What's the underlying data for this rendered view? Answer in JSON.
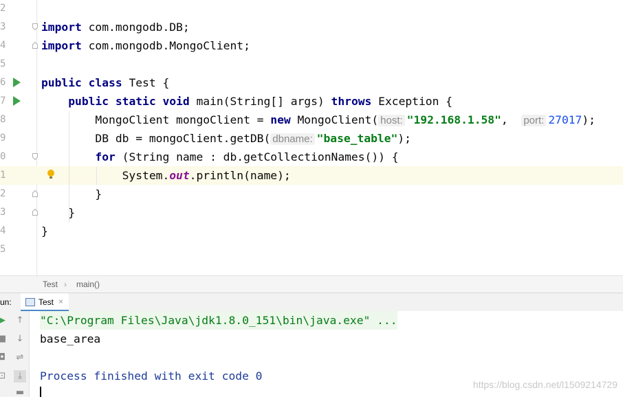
{
  "editor": {
    "lines": [
      {
        "num": "2",
        "tokens": []
      },
      {
        "num": "3",
        "tokens": [
          {
            "t": "import",
            "c": "kw"
          },
          {
            "t": " com.mongodb.DB;",
            "c": ""
          }
        ]
      },
      {
        "num": "4",
        "tokens": [
          {
            "t": "import",
            "c": "kw"
          },
          {
            "t": " com.mongodb.MongoClient;",
            "c": ""
          }
        ]
      },
      {
        "num": "5",
        "tokens": []
      },
      {
        "num": "6",
        "tokens": [
          {
            "t": "public class",
            "c": "kw"
          },
          {
            "t": " Test {",
            "c": ""
          }
        ]
      },
      {
        "num": "7",
        "tokens": [
          {
            "t": "    ",
            "c": ""
          },
          {
            "t": "public static void",
            "c": "kw"
          },
          {
            "t": " main(String[] args) ",
            "c": ""
          },
          {
            "t": "throws",
            "c": "kw"
          },
          {
            "t": " Exception {",
            "c": ""
          }
        ]
      },
      {
        "num": "8",
        "tokens": [
          {
            "t": "        MongoClient mongoClient = ",
            "c": ""
          },
          {
            "t": "new",
            "c": "kw"
          },
          {
            "t": " MongoClient(",
            "c": ""
          },
          {
            "t": "host:",
            "c": "hint"
          },
          {
            "t": "\"192.168.1.58\"",
            "c": "str"
          },
          {
            "t": ",  ",
            "c": ""
          },
          {
            "t": "port:",
            "c": "hint"
          },
          {
            "t": "27017",
            "c": "num"
          },
          {
            "t": ");",
            "c": ""
          }
        ]
      },
      {
        "num": "9",
        "tokens": [
          {
            "t": "        DB db = mongoClient.getDB(",
            "c": ""
          },
          {
            "t": "dbname:",
            "c": "hint"
          },
          {
            "t": "\"base_table\"",
            "c": "str"
          },
          {
            "t": ");",
            "c": ""
          }
        ]
      },
      {
        "num": "0",
        "tokens": [
          {
            "t": "        ",
            "c": ""
          },
          {
            "t": "for",
            "c": "kw"
          },
          {
            "t": " (String name : db.getCollectionNames()) {",
            "c": ""
          }
        ]
      },
      {
        "num": "1",
        "tokens": [
          {
            "t": "            System.",
            "c": ""
          },
          {
            "t": "out",
            "c": "fld"
          },
          {
            "t": ".println(name);",
            "c": ""
          }
        ]
      },
      {
        "num": "2",
        "tokens": [
          {
            "t": "        }",
            "c": ""
          }
        ]
      },
      {
        "num": "3",
        "tokens": [
          {
            "t": "    }",
            "c": ""
          }
        ]
      },
      {
        "num": "4",
        "tokens": [
          {
            "t": "}",
            "c": ""
          }
        ]
      },
      {
        "num": "5",
        "tokens": []
      }
    ]
  },
  "breadcrumb": {
    "class_name": "Test",
    "method_name": "main()"
  },
  "run_panel": {
    "run_label": "un:",
    "tab_label": "Test",
    "close_glyph": "×",
    "command_line": "\"C:\\Program Files\\Java\\jdk1.8.0_151\\bin\\java.exe\" ...",
    "output_line": "base_area",
    "exit_message": "Process finished with exit code 0"
  },
  "watermark": "https://blog.csdn.net/l1509214729",
  "colors": {
    "keyword": "#000080",
    "string": "#067d17",
    "number": "#1750eb",
    "field": "#871094",
    "run_arrow": "#3fa34d"
  },
  "icons": {
    "run_gutter": "run-arrow-icon",
    "bulb": "lightbulb-icon",
    "tools": [
      "rerun-icon",
      "scroll-up-icon",
      "stop-icon",
      "scroll-down-icon",
      "camera-icon",
      "soft-wrap-icon",
      "restore-icon",
      "scroll-to-end-icon",
      "print-icon"
    ]
  }
}
